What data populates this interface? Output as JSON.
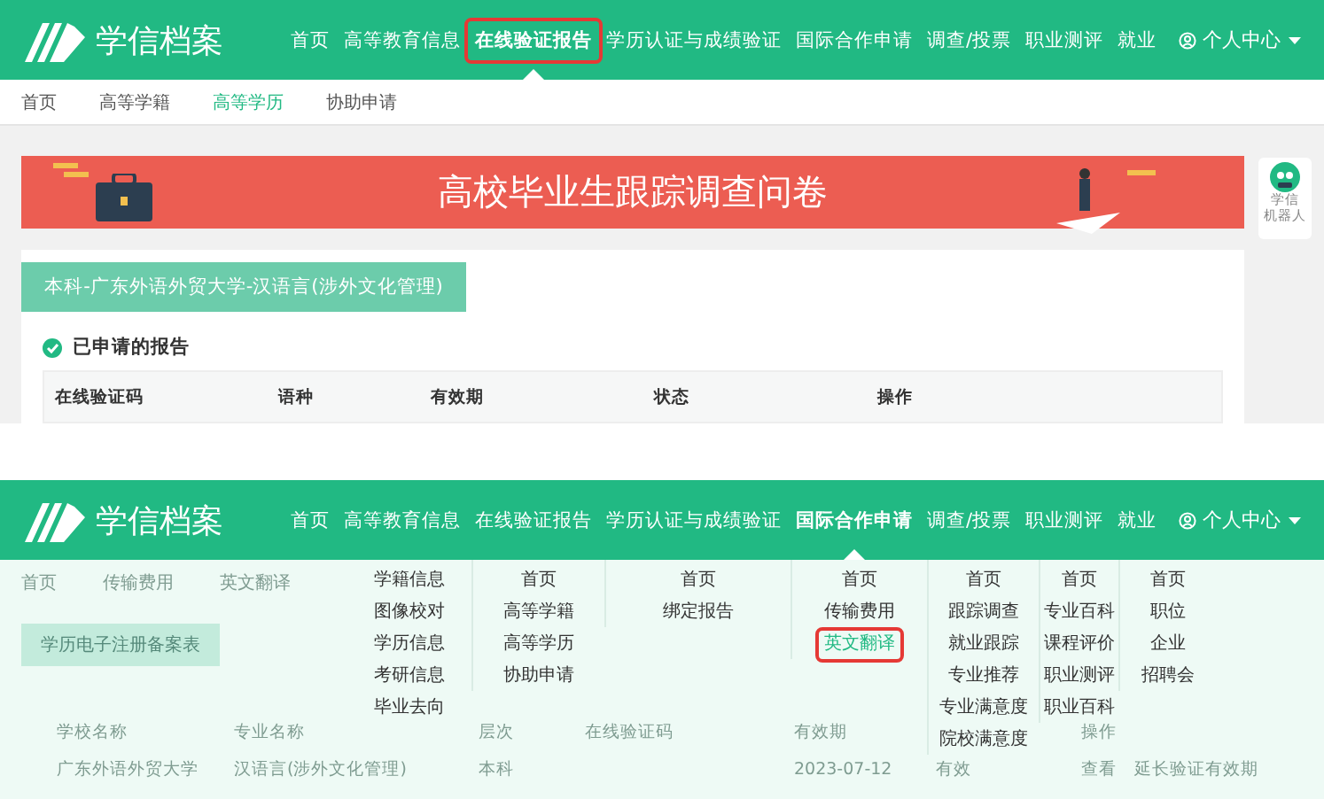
{
  "top_screen": {
    "nav": {
      "logo": "学信档案",
      "items": [
        {
          "label": "首页",
          "selected": false,
          "highlighted": false
        },
        {
          "label": "高等教育信息",
          "selected": false,
          "highlighted": false
        },
        {
          "label": "在线验证报告",
          "selected": true,
          "highlighted": true
        },
        {
          "label": "学历认证与成绩验证",
          "selected": false,
          "highlighted": false
        },
        {
          "label": "国际合作申请",
          "selected": false,
          "highlighted": false
        },
        {
          "label": "调查/投票",
          "selected": false,
          "highlighted": false
        },
        {
          "label": "职业测评",
          "selected": false,
          "highlighted": false
        },
        {
          "label": "就业",
          "selected": false,
          "highlighted": false
        }
      ],
      "user_menu": "个人中心"
    },
    "subnav": [
      {
        "label": "首页",
        "selected": false
      },
      {
        "label": "高等学籍",
        "selected": false
      },
      {
        "label": "高等学历",
        "selected": true
      },
      {
        "label": "协助申请",
        "selected": false
      }
    ],
    "banner": {
      "title": "高校毕业生跟踪调查问卷"
    },
    "robot": {
      "lines": [
        "学信",
        "机器人"
      ]
    },
    "card": {
      "tag": "本科-广东外语外贸大学-汉语言(涉外文化管理)",
      "section_title": "已申请的报告",
      "columns": [
        "在线验证码",
        "语种",
        "有效期",
        "状态",
        "操作"
      ]
    }
  },
  "bottom_screen": {
    "nav": {
      "logo": "学信档案",
      "items": [
        {
          "label": "首页",
          "selected": false,
          "highlighted": false
        },
        {
          "label": "高等教育信息",
          "selected": false,
          "highlighted": false
        },
        {
          "label": "在线验证报告",
          "selected": false,
          "highlighted": false
        },
        {
          "label": "学历认证与成绩验证",
          "selected": false,
          "highlighted": false
        },
        {
          "label": "国际合作申请",
          "selected": true,
          "highlighted": false
        },
        {
          "label": "调查/投票",
          "selected": false,
          "highlighted": false
        },
        {
          "label": "职业测评",
          "selected": false,
          "highlighted": false
        },
        {
          "label": "就业",
          "selected": false,
          "highlighted": false
        }
      ],
      "user_menu": "个人中心"
    },
    "background": {
      "subnav": [
        "首页",
        "传输费用",
        "英文翻译"
      ],
      "tag": "学历电子注册备案表",
      "columns": [
        "学校名称",
        "专业名称",
        "层次",
        "在线验证码",
        "有效期",
        "操作"
      ],
      "row": [
        "广东外语外贸大学",
        "汉语言(涉外文化管理)",
        "本科",
        "2023-07-12",
        "有效",
        "查看",
        "延长验证有效期"
      ]
    },
    "dropdown": [
      [
        {
          "label": "学籍信息",
          "selected": false,
          "highlighted": false
        },
        {
          "label": "图像校对",
          "selected": false,
          "highlighted": false
        },
        {
          "label": "学历信息",
          "selected": false,
          "highlighted": false
        },
        {
          "label": "考研信息",
          "selected": false,
          "highlighted": false
        },
        {
          "label": "毕业去向",
          "selected": false,
          "highlighted": false
        }
      ],
      [
        {
          "label": "首页",
          "selected": false,
          "highlighted": false
        },
        {
          "label": "高等学籍",
          "selected": false,
          "highlighted": false
        },
        {
          "label": "高等学历",
          "selected": false,
          "highlighted": false
        },
        {
          "label": "协助申请",
          "selected": false,
          "highlighted": false
        }
      ],
      [
        {
          "label": "首页",
          "selected": false,
          "highlighted": false
        },
        {
          "label": "绑定报告",
          "selected": false,
          "highlighted": false
        }
      ],
      [
        {
          "label": "首页",
          "selected": false,
          "highlighted": false
        },
        {
          "label": "传输费用",
          "selected": false,
          "highlighted": false
        },
        {
          "label": "英文翻译",
          "selected": true,
          "highlighted": true
        }
      ],
      [
        {
          "label": "首页",
          "selected": false,
          "highlighted": false
        },
        {
          "label": "跟踪调查",
          "selected": false,
          "highlighted": false
        },
        {
          "label": "就业跟踪",
          "selected": false,
          "highlighted": false
        },
        {
          "label": "专业推荐",
          "selected": false,
          "highlighted": false
        },
        {
          "label": "专业满意度",
          "selected": false,
          "highlighted": false
        },
        {
          "label": "院校满意度",
          "selected": false,
          "highlighted": false
        }
      ],
      [
        {
          "label": "首页",
          "selected": false,
          "highlighted": false
        },
        {
          "label": "专业百科",
          "selected": false,
          "highlighted": false
        },
        {
          "label": "课程评价",
          "selected": false,
          "highlighted": false
        },
        {
          "label": "职业测评",
          "selected": false,
          "highlighted": false
        },
        {
          "label": "职业百科",
          "selected": false,
          "highlighted": false
        }
      ],
      [
        {
          "label": "首页",
          "selected": false,
          "highlighted": false
        },
        {
          "label": "职位",
          "selected": false,
          "highlighted": false
        },
        {
          "label": "企业",
          "selected": false,
          "highlighted": false
        },
        {
          "label": "招聘会",
          "selected": false,
          "highlighted": false
        }
      ]
    ]
  }
}
